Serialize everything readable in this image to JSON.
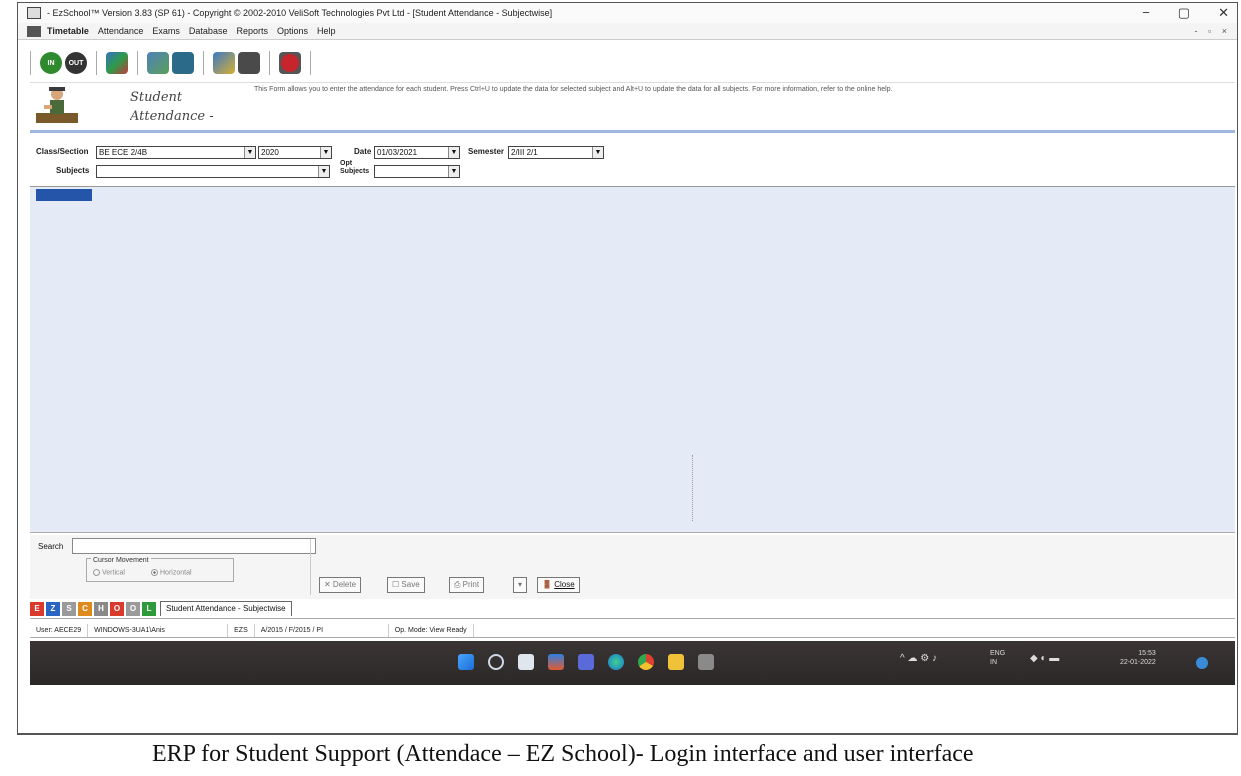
{
  "window": {
    "title": "- EzSchool™ Version 3.83 (SP 61) - Copyright © 2002-2010 VeliSoft Technologies Pvt Ltd - [Student Attendance - Subjectwise]",
    "controls": [
      "−",
      "▢",
      "✕"
    ]
  },
  "menu": {
    "items": [
      "Timetable",
      "Attendance",
      "Exams",
      "Database",
      "Reports",
      "Options",
      "Help"
    ],
    "mdi_controls": "- ▫ ×"
  },
  "toolbar": {
    "in_label": "IN",
    "out_label": "OUT"
  },
  "header": {
    "form_title": "Student Attendance - Subjectwise",
    "description": "This Form allows you to enter the attendance for each student. Press Ctrl+U to update the data for selected subject and Alt+U to update the data for all subjects. For more information, refer to the online help."
  },
  "filters": {
    "class_label": "Class/Section",
    "class_value": "BE ECE 2/4B",
    "year_value": "2020",
    "date_label": "Date",
    "date_value": "01/03/2021",
    "semester_label": "Semester",
    "semester_value": "2/III 2/1",
    "subjects_label": "Subjects",
    "subjects_value": "",
    "opt_subjects_label": "Opt Subjects",
    "opt_subjects_value": "",
    "dropdown_arrow": "▼"
  },
  "bottom": {
    "search_label": "Search",
    "search_value": "",
    "cursor_movement_label": "Cursor Movement",
    "vertical_label": "Vertical",
    "horizontal_label": "Horizontal",
    "delete_label": "✕ Delete",
    "save_label": "Save",
    "print_label": "Print",
    "print_arrow": "▾",
    "close_label": "Close"
  },
  "tabs": {
    "modules": [
      {
        "letter": "E",
        "color": "#d93a2b"
      },
      {
        "letter": "Z",
        "color": "#2a64c4"
      },
      {
        "letter": "S",
        "color": "#9a9a9a"
      },
      {
        "letter": "C",
        "color": "#e08a1e"
      },
      {
        "letter": "H",
        "color": "#8a8a8a"
      },
      {
        "letter": "O",
        "color": "#d93a2b"
      },
      {
        "letter": "O",
        "color": "#9a9a9a"
      },
      {
        "letter": "L",
        "color": "#2e9a3a"
      }
    ],
    "active_tab": "Student Attendance - Subjectwise"
  },
  "status": {
    "user": "User: AECE29",
    "machine": "WINDOWS-3UA1\\Anis",
    "code": "EZS",
    "session": "A/2015 / F/2015 / PI",
    "message": "Op. Mode: View Ready"
  },
  "taskbar": {
    "lang_top": "ENG",
    "lang_bottom": "IN",
    "time": "15:53",
    "date": "22-01-2022"
  },
  "caption": "ERP for Student Support (Attendace – EZ School)- Login interface and user interface"
}
